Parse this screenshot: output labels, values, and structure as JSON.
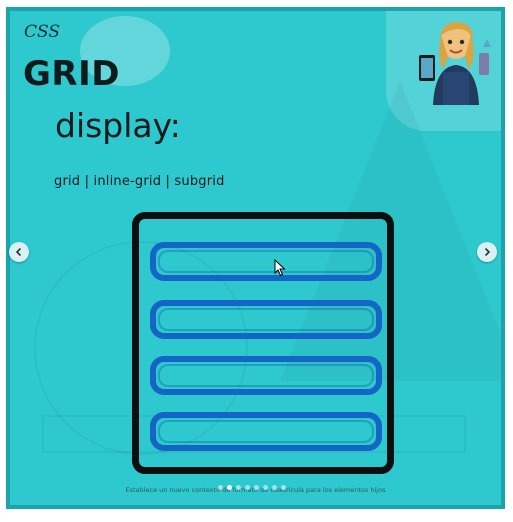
{
  "slide": {
    "kicker": "CSS",
    "title": "GRID",
    "subtitle": "display:",
    "values": "grid | inline-grid | subgrid",
    "caption": "Establece un nuevo contexto de formato de cuadrícula para los elementos hijos"
  },
  "carousel": {
    "prev_icon": "chevron-left-icon",
    "next_icon": "chevron-right-icon",
    "dot_count": 8,
    "active_dot": 1
  },
  "illustration": {
    "rows": 4,
    "box_color": "#0c0f10",
    "row_color": "#1565c6"
  },
  "colors": {
    "background": "#2ec9cf",
    "border": "#1aa5ad",
    "text": "#0f1a1c"
  }
}
